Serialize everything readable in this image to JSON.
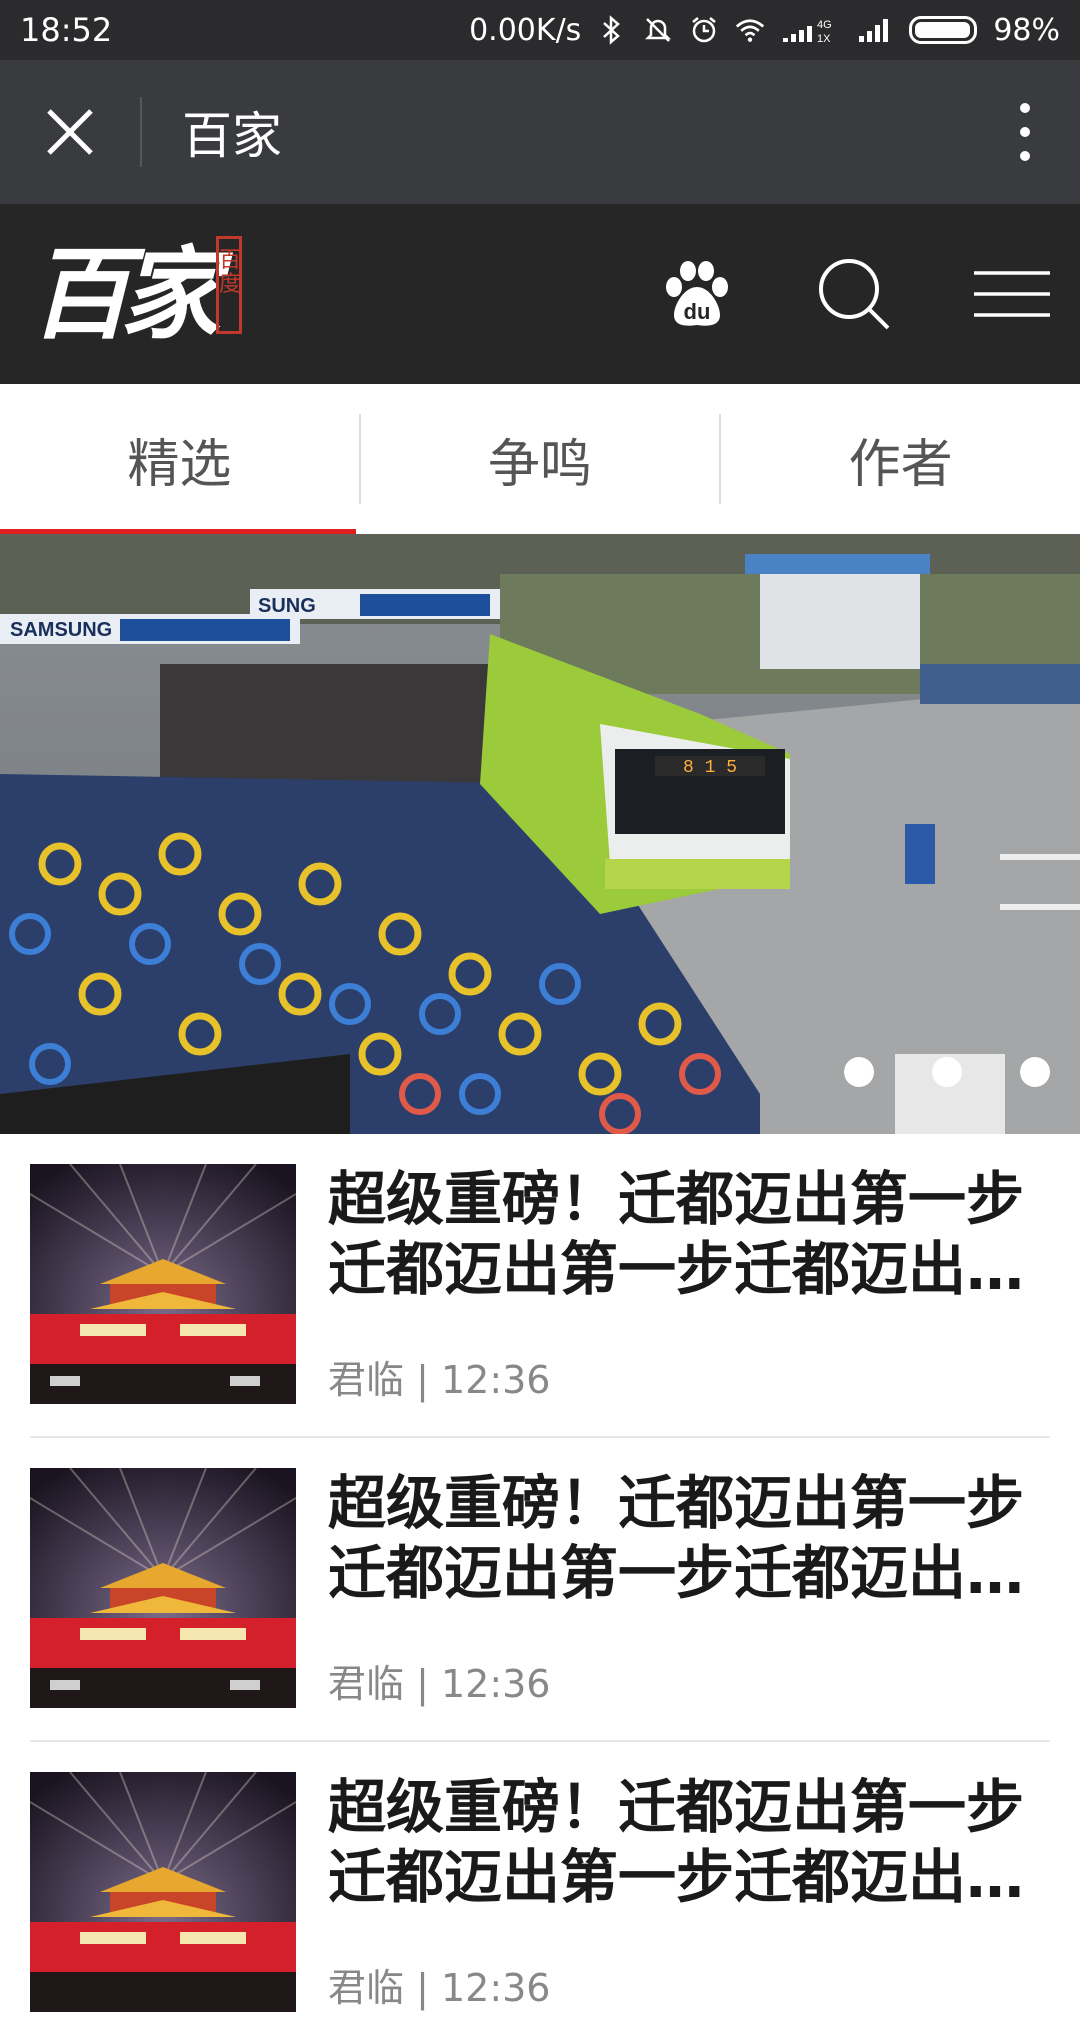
{
  "status_bar": {
    "time": "18:52",
    "speed": "0.00K/s",
    "battery": "98%",
    "battery_level": 0.98,
    "icons": [
      "bluetooth-icon",
      "mute-icon",
      "alarm-icon",
      "wifi-icon",
      "signal-4g-icon",
      "signal-icon",
      "battery-icon"
    ]
  },
  "app_bar": {
    "title": "百家",
    "close_icon": "close-icon",
    "more_icon": "more-vertical-icon"
  },
  "brand_bar": {
    "logo_text": "百家",
    "logo_seal": "百度",
    "icons": [
      "baidu-paw-icon",
      "search-icon",
      "menu-icon"
    ]
  },
  "tabs": [
    {
      "label": "精选",
      "active": true
    },
    {
      "label": "争鸣",
      "active": false
    },
    {
      "label": "作者",
      "active": false
    }
  ],
  "banner": {
    "image": "bike-station-photo",
    "bus_display": "8 1 5",
    "slide_count": 3
  },
  "articles": [
    {
      "title": "超级重磅！迁都迈出第一步迁都迈出第一步迁都迈出第一步迁都迈出第一步",
      "author": "君临",
      "time": "12:36",
      "meta": "君临 | 12:36",
      "thumb": "tiananmen-night-photo"
    },
    {
      "title": "超级重磅！迁都迈出第一步迁都迈出第一步迁都迈出第一步迁都迈出第一步",
      "author": "君临",
      "time": "12:36",
      "meta": "君临 | 12:36",
      "thumb": "tiananmen-night-photo"
    },
    {
      "title": "超级重磅！迁都迈出第一步迁都迈出第一步迁都迈出第一步迁都迈出第一步",
      "author": "君临",
      "time": "12:36",
      "meta": "君临 | 12:36",
      "thumb": "tiananmen-night-photo"
    }
  ]
}
